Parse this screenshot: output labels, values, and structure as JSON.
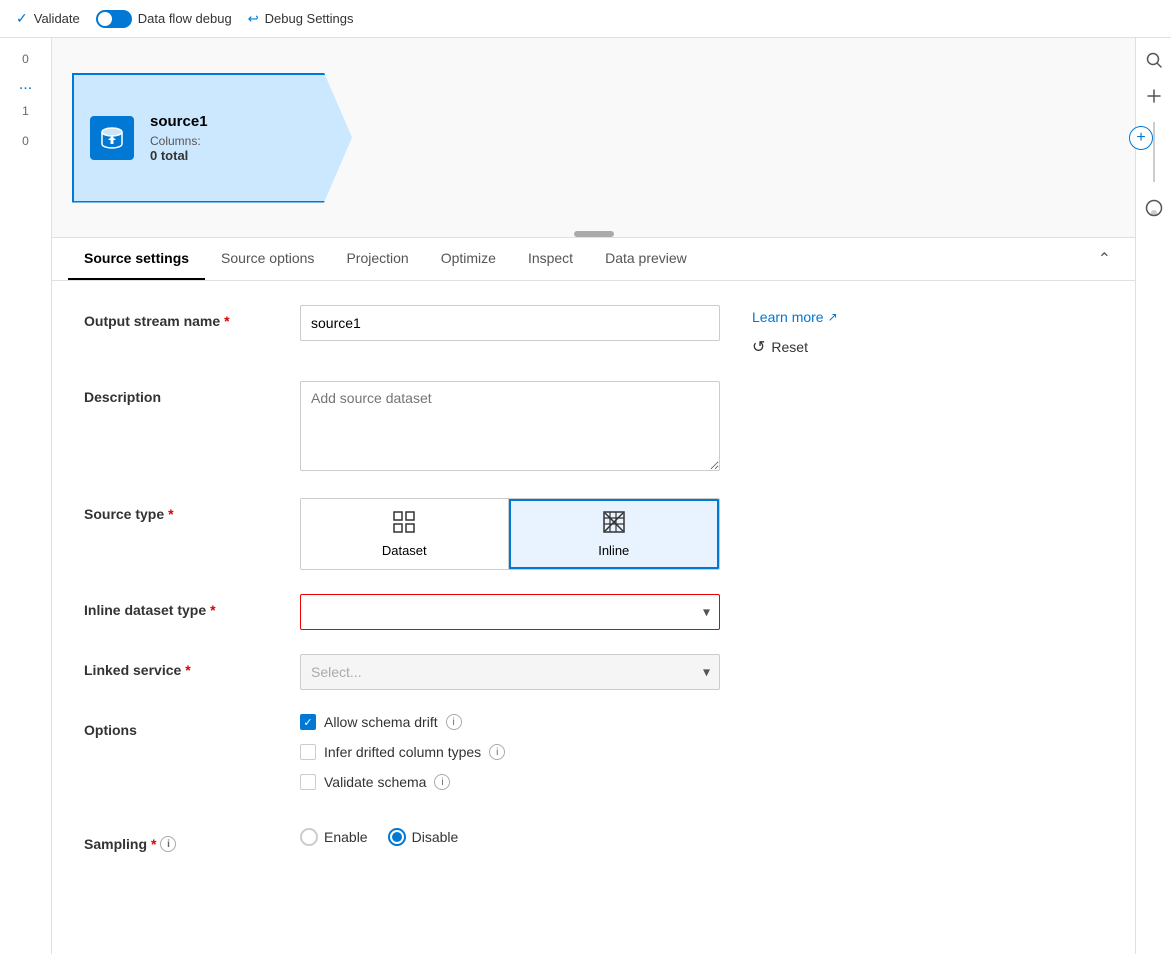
{
  "topbar": {
    "validate_label": "Validate",
    "dataflow_debug_label": "Data flow debug",
    "debug_settings_label": "Debug Settings"
  },
  "sidebar_left": {
    "items": [
      "0",
      "...",
      "1",
      "0"
    ]
  },
  "node": {
    "title": "source1",
    "columns_label": "Columns:",
    "columns_count": "0 total",
    "add_btn": "+"
  },
  "tabs": {
    "items": [
      "Source settings",
      "Source options",
      "Projection",
      "Optimize",
      "Inspect",
      "Data preview"
    ],
    "active_index": 0
  },
  "form": {
    "output_stream_name_label": "Output stream name",
    "output_stream_name_value": "source1",
    "description_label": "Description",
    "description_placeholder": "Add source dataset",
    "source_type_label": "Source type",
    "dataset_btn_label": "Dataset",
    "inline_btn_label": "Inline",
    "inline_dataset_type_label": "Inline dataset type",
    "linked_service_label": "Linked service",
    "linked_service_placeholder": "Select...",
    "options_label": "Options",
    "allow_schema_drift_label": "Allow schema drift",
    "infer_drifted_label": "Infer drifted column types",
    "validate_schema_label": "Validate schema",
    "sampling_label": "Sampling",
    "enable_label": "Enable",
    "disable_label": "Disable",
    "learn_more_label": "Learn more",
    "reset_label": "Reset"
  }
}
